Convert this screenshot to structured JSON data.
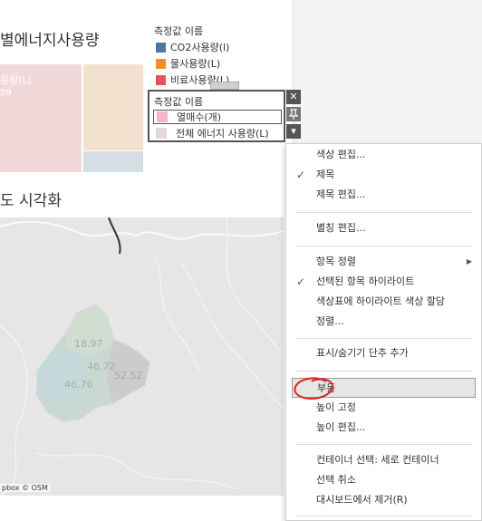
{
  "sheet_title": "별에너지사용량",
  "map_title": "도 시각화",
  "treemap": {
    "label": "용량(L)",
    "value": "59"
  },
  "map": {
    "attribution": "pbox © OSM",
    "values": [
      "18.97",
      "46.72",
      "52.52",
      "46.76"
    ]
  },
  "legend1": {
    "title": "측정값 이름",
    "items": [
      {
        "label": "CO2사용량(l)",
        "color": "#4e79a7"
      },
      {
        "label": "물사용량(L)",
        "color": "#f28e2b"
      },
      {
        "label": "비료사용량(L)",
        "color": "#e15759"
      }
    ]
  },
  "legend2": {
    "title": "측정값 이름",
    "items": [
      {
        "label": "열매수(개)",
        "color": "#f4b6c8"
      },
      {
        "label": "전체 에너지 사용량(L)",
        "color": "#e2d8de"
      }
    ],
    "controls": {
      "close": "✕",
      "pin": "🖈",
      "menu": "▾"
    }
  },
  "menu": {
    "items": [
      {
        "label": "색상 편집...",
        "checked": false
      },
      {
        "label": "제목",
        "checked": true
      },
      {
        "label": "제목 편집...",
        "checked": false
      },
      {
        "label": "별칭 편집...",
        "checked": false
      },
      {
        "label": "항목 정렬",
        "checked": false,
        "submenu": true
      },
      {
        "label": "선택된 항목 하이라이트",
        "checked": true
      },
      {
        "label": "색상표에 하이라이트 색상 할당",
        "checked": false
      },
      {
        "label": "정렬...",
        "checked": false
      },
      {
        "label": "표시/숨기기 단추 추가",
        "checked": false
      },
      {
        "label": "부동",
        "checked": false,
        "hover": true
      },
      {
        "label": "높이 고정",
        "checked": false
      },
      {
        "label": "높이 편집...",
        "checked": false
      },
      {
        "label": "컨테이너 선택: 세로 컨테이너",
        "checked": false
      },
      {
        "label": "선택 취소",
        "checked": false
      },
      {
        "label": "대시보드에서 제거(R)",
        "checked": false
      }
    ],
    "check_glyph": "✓",
    "submenu_glyph": "▶"
  }
}
